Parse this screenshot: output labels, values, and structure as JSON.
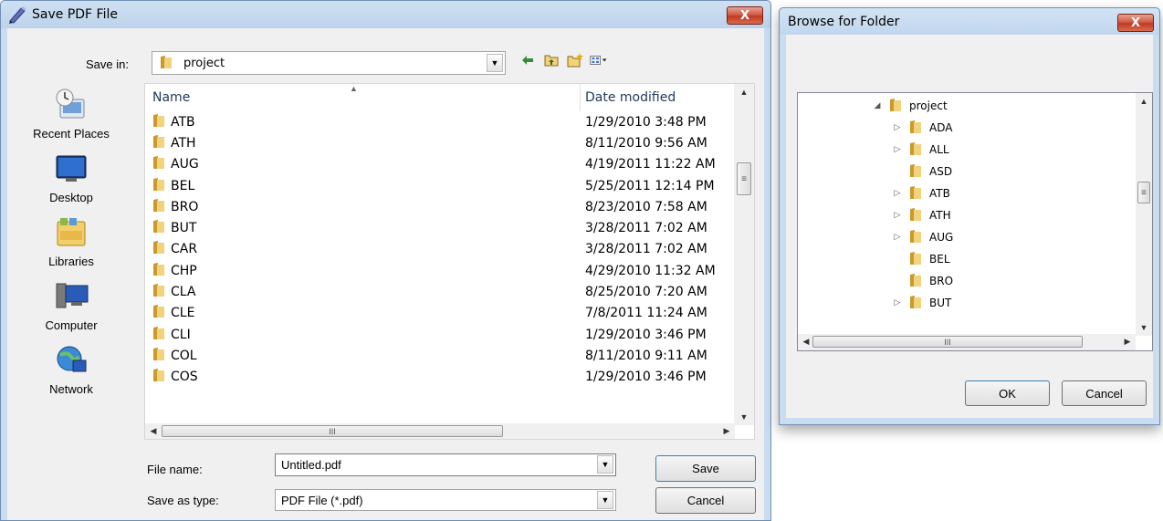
{
  "save_dialog": {
    "title": "Save PDF File",
    "close_label": "X",
    "save_in_label": "Save in:",
    "save_in_value": "project",
    "places": [
      {
        "label": "Recent Places",
        "icon": "recent-places-icon"
      },
      {
        "label": "Desktop",
        "icon": "desktop-icon"
      },
      {
        "label": "Libraries",
        "icon": "libraries-icon"
      },
      {
        "label": "Computer",
        "icon": "computer-icon"
      },
      {
        "label": "Network",
        "icon": "network-icon"
      }
    ],
    "columns": {
      "name": "Name",
      "date": "Date modified"
    },
    "files": [
      {
        "name": "ATB",
        "date": "1/29/2010 3:48 PM"
      },
      {
        "name": "ATH",
        "date": "8/11/2010 9:56 AM"
      },
      {
        "name": "AUG",
        "date": "4/19/2011 11:22 AM"
      },
      {
        "name": "BEL",
        "date": "5/25/2011 12:14 PM"
      },
      {
        "name": "BRO",
        "date": "8/23/2010 7:58 AM"
      },
      {
        "name": "BUT",
        "date": "3/28/2011 7:02 AM"
      },
      {
        "name": "CAR",
        "date": "3/28/2011 7:02 AM"
      },
      {
        "name": "CHP",
        "date": "4/29/2010 11:32 AM"
      },
      {
        "name": "CLA",
        "date": "8/25/2010 7:20 AM"
      },
      {
        "name": "CLE",
        "date": "7/8/2011 11:24 AM"
      },
      {
        "name": "CLI",
        "date": "1/29/2010 3:46 PM"
      },
      {
        "name": "COL",
        "date": "8/11/2010 9:11 AM"
      },
      {
        "name": "COS",
        "date": "1/29/2010 3:46 PM"
      }
    ],
    "file_name_label": "File name:",
    "file_name_value": "Untitled.pdf",
    "save_as_type_label": "Save as type:",
    "save_as_type_value": "PDF File (*.pdf)",
    "save_button": "Save",
    "cancel_button": "Cancel",
    "scroll_grip": "III",
    "vscroll_grip": "≡"
  },
  "browse_dialog": {
    "title": "Browse for Folder",
    "close_label": "X",
    "tree": [
      {
        "label": "project",
        "toggle": "◢",
        "level": 0
      },
      {
        "label": "ADA",
        "toggle": "▷",
        "level": 1
      },
      {
        "label": "ALL",
        "toggle": "▷",
        "level": 1
      },
      {
        "label": "ASD",
        "toggle": "",
        "level": 1
      },
      {
        "label": "ATB",
        "toggle": "▷",
        "level": 1
      },
      {
        "label": "ATH",
        "toggle": "▷",
        "level": 1
      },
      {
        "label": "AUG",
        "toggle": "▷",
        "level": 1
      },
      {
        "label": "BEL",
        "toggle": "",
        "level": 1
      },
      {
        "label": "BRO",
        "toggle": "",
        "level": 1
      },
      {
        "label": "BUT",
        "toggle": "▷",
        "level": 1
      }
    ],
    "ok_button": "OK",
    "cancel_button": "Cancel",
    "scroll_grip": "III"
  },
  "colors": {
    "title_bar": "#c9dcf0",
    "close_button": "#c9452c",
    "folder": "#e8b84a",
    "header_text": "#1e395b"
  }
}
